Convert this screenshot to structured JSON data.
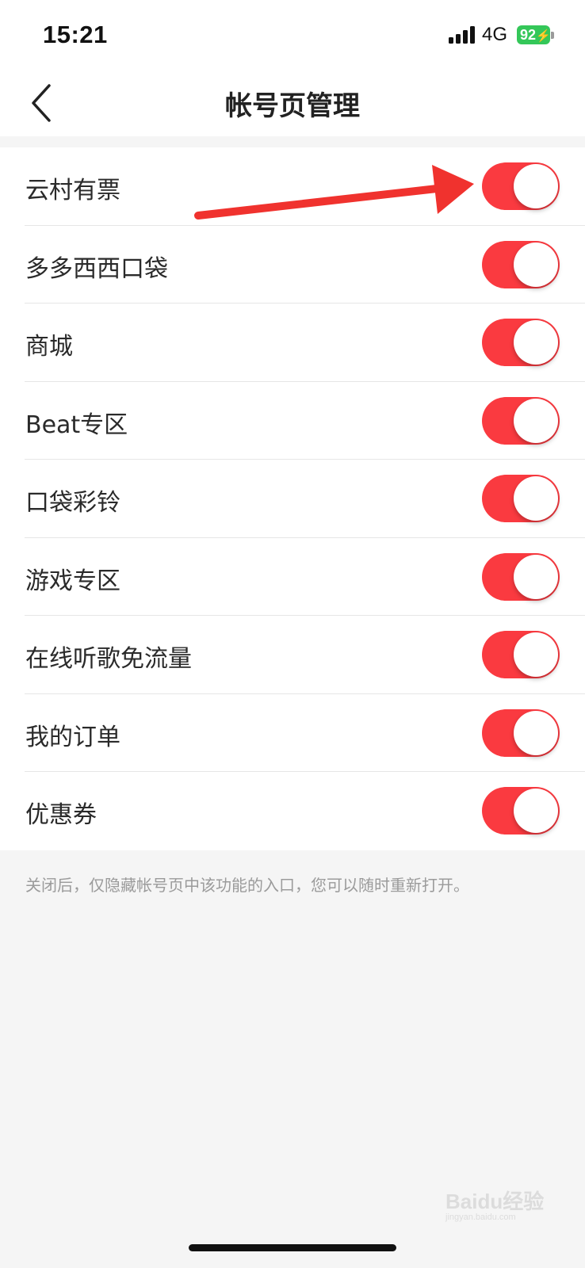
{
  "status_bar": {
    "time": "15:21",
    "network": "4G",
    "battery": "92"
  },
  "nav": {
    "title": "帐号页管理",
    "back_icon": "chevron-left-icon"
  },
  "settings": {
    "items": [
      {
        "label": "云村有票",
        "enabled": true
      },
      {
        "label": "多多西西口袋",
        "enabled": true
      },
      {
        "label": "商城",
        "enabled": true
      },
      {
        "label": "Beat专区",
        "enabled": true
      },
      {
        "label": "口袋彩铃",
        "enabled": true
      },
      {
        "label": "游戏专区",
        "enabled": true
      },
      {
        "label": "在线听歌免流量",
        "enabled": true
      },
      {
        "label": "我的订单",
        "enabled": true
      },
      {
        "label": "优惠券",
        "enabled": true
      }
    ],
    "footnote": "关闭后，仅隐藏帐号页中该功能的入口，您可以随时重新打开。"
  },
  "watermark": {
    "text": "Baidu经验",
    "sub": "jingyan.baidu.com"
  },
  "colors": {
    "toggle_on": "#fa3a40",
    "battery": "#34c759",
    "arrow": "#f0322e"
  }
}
